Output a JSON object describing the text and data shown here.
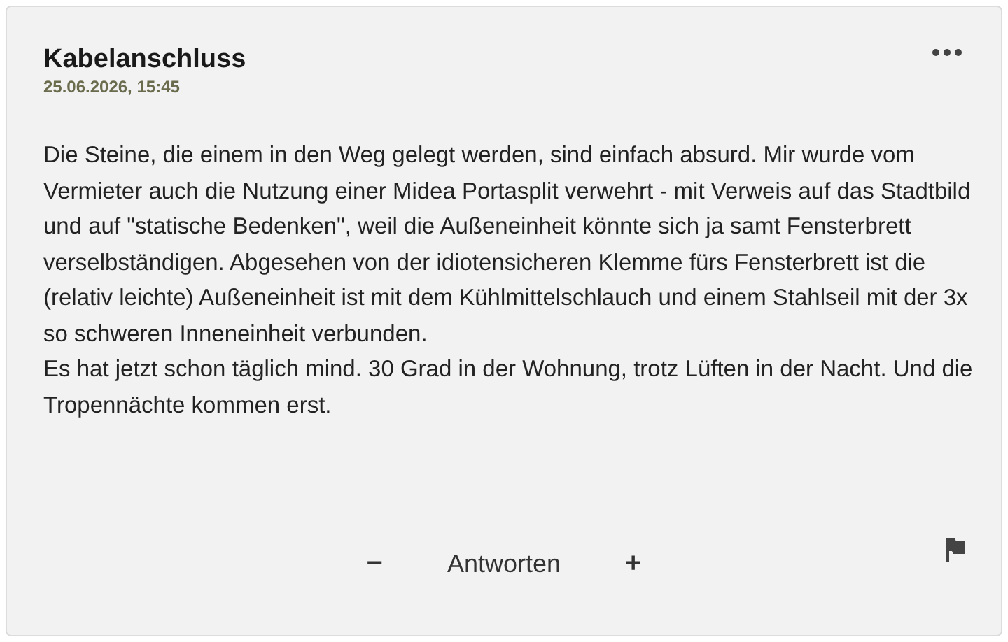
{
  "comment": {
    "author": "Kabelanschluss",
    "date": "25.06.2026, 15:45",
    "paragraphs": [
      "Die Steine, die einem in den Weg gelegt werden, sind einfach absurd. Mir wurde vom Vermieter auch die Nutzung einer Midea Portasplit verwehrt - mit Verweis auf das Stadtbild und auf \"statische Bedenken\", weil die Außeneinheit könnte sich ja samt Fensterbrett verselbständigen. Abgesehen von der idiotensicheren Klemme fürs Fensterbrett ist die (relativ leichte) Außeneinheit ist mit dem Kühlmittelschlauch und einem Stahlseil mit der 3x so schweren Inneneinheit verbunden.",
      "Es hat jetzt schon täglich mind. 30 Grad in der Wohnung, trotz Lüften in der Nacht. Und die Tropennächte kommen erst."
    ],
    "minus": "−",
    "reply": "Antworten",
    "plus": "+"
  }
}
